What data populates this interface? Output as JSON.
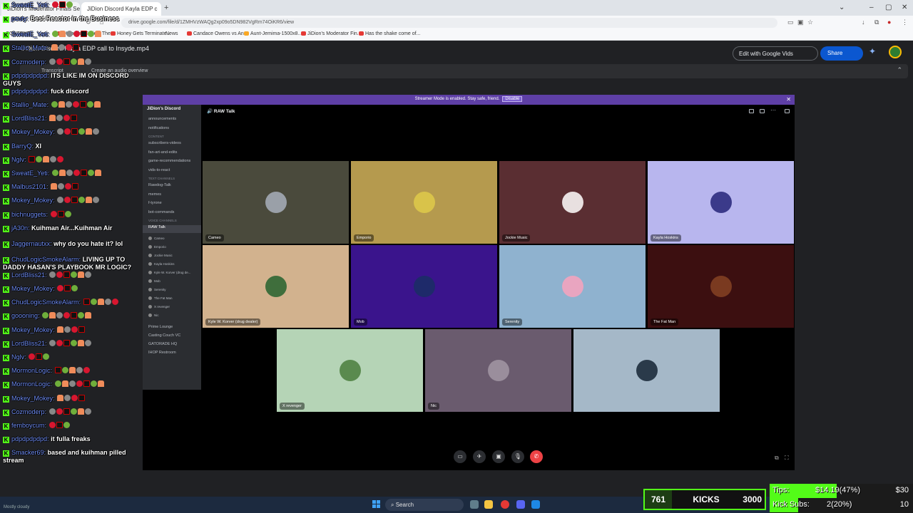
{
  "browser": {
    "tabs": [
      {
        "label": "JiDion's Moderator Finals Season"
      },
      {
        "label": "JiDion Discord Kayla EDP c"
      }
    ],
    "url": "drive.google.com/file/d/1ZMHVzWAQg2xp09o5DN982VgRm74OiKR6/view",
    "bookmarks": [
      "CONTENT",
      "Halo The Series, The...",
      "Honey Gets Terminate...",
      "News",
      "Candace Owens vs An...",
      "Aunt-Jemima-1500x8...",
      "JiDion's Moderator Fin...",
      "Has the shake come of..."
    ]
  },
  "drive": {
    "file_title": "JiDion Discord Kayla EDP call to Insyde.mp4",
    "edit_vids_label": "Edit with Google Vids",
    "share_label": "Share",
    "transcript_label": "Transcript",
    "audio_overview_label": "Create an audio overview"
  },
  "discord": {
    "banner_text": "Streamer Mode is enabled. Stay safe, friend.",
    "banner_disable": "Disable",
    "server_name": "JiDion's Discord",
    "channel_header": "RAW Talk",
    "channels": [
      {
        "label": "announcements",
        "type": "text"
      },
      {
        "label": "notifications",
        "type": "text"
      },
      {
        "label": "CONTENT",
        "type": "cat"
      },
      {
        "label": "subscribers-videos",
        "type": "text"
      },
      {
        "label": "fan-art-and-edits",
        "type": "text"
      },
      {
        "label": "game-recommendations",
        "type": "text"
      },
      {
        "label": "vids-to-react",
        "type": "text"
      },
      {
        "label": "TEXT CHANNELS",
        "type": "cat"
      },
      {
        "label": "Rawdog-Talk",
        "type": "text"
      },
      {
        "label": "memes",
        "type": "text"
      },
      {
        "label": "f-tyrone",
        "type": "text"
      },
      {
        "label": "bot-commands",
        "type": "text"
      },
      {
        "label": "VOICE CHANNELS",
        "type": "cat"
      },
      {
        "label": "RAW Talk",
        "type": "active"
      }
    ],
    "voice_members": [
      "Cameo",
      "Emporio",
      "Jockie Music",
      "Kayla Hoskins",
      "Kyle W. Korver (drug de...",
      "Mob",
      "Serenity",
      "The Fat Man",
      "X revenger",
      "Nic"
    ],
    "other_voice": [
      "Prime Lounge",
      "Casting Couch VC",
      "GATORADE HQ",
      "IHOP Restroom"
    ],
    "participants": [
      {
        "name": "Cameo",
        "bg": "#4a4a3c",
        "av": "#9aa0a8"
      },
      {
        "name": "Emporio",
        "bg": "#b59a4e",
        "av": "#d9c34a"
      },
      {
        "name": "Jockie Music",
        "bg": "#5a2e32",
        "av": "#e8e0e0"
      },
      {
        "name": "Kayla Hoskins",
        "bg": "#b8b6ee",
        "av": "#3b3a8a"
      },
      {
        "name": "Kyle W. Korver (drug dealer)",
        "bg": "#d2b28e",
        "av": "#3f6e3c"
      },
      {
        "name": "Mob",
        "bg": "#3a148c",
        "av": "#1e2a6a"
      },
      {
        "name": "Serenity",
        "bg": "#8fb2cf",
        "av": "#e9a5c0"
      },
      {
        "name": "The Fat Man",
        "bg": "#3c0f10",
        "av": "#7a3a20"
      },
      {
        "name": "X revenger",
        "bg": "#b5d4b6",
        "av": "#5a8a4e"
      },
      {
        "name": "Nic",
        "bg": "#6a5b6e",
        "av": "#9a8e9c"
      },
      {
        "name": "",
        "bg": "#a5b8c8",
        "av": "#2a3a4a"
      }
    ]
  },
  "chat": [
    {
      "user": "SweatE_Yeti:",
      "text": ""
    },
    {
      "user": "pcuty:",
      "text": "Best Reactor in the Business"
    },
    {
      "user": "SweatE_Yeti:",
      "text": ""
    },
    {
      "user": "Stallio_Mate:",
      "text": ""
    },
    {
      "user": "Cozmoderp:",
      "text": ""
    },
    {
      "user": "pdpdpdpdpd:",
      "text": "ITS LIKE IM ON DISCORD GUYS"
    },
    {
      "user": "pdpdpdpdpd:",
      "text": "fuck discord"
    },
    {
      "user": "Stallio_Mate:",
      "text": ""
    },
    {
      "user": "LordBliss21:",
      "text": ""
    },
    {
      "user": "Mokey_Mokey:",
      "text": ""
    },
    {
      "user": "BarryQ:",
      "text": "XI"
    },
    {
      "user": "Nglv:",
      "text": ""
    },
    {
      "user": "SweatE_Yeti:",
      "text": ""
    },
    {
      "user": "Malbus2101:",
      "text": ""
    },
    {
      "user": "Mokey_Mokey:",
      "text": ""
    },
    {
      "user": "bichnuggets:",
      "text": ""
    },
    {
      "user": "jA30n:",
      "text": "Kuihman Air...Kuihman Air"
    },
    {
      "user": "Jaggernautxx:",
      "text": "why do you hate it? lol"
    },
    {
      "user": "ChudLogicSmokeAlarm:",
      "text": "LIVING UP TO DADDY HASAN'S PLAYBOOK MR LOGIC?"
    },
    {
      "user": "LordBliss21:",
      "text": ""
    },
    {
      "user": "Mokey_Mokey:",
      "text": ""
    },
    {
      "user": "ChudLogicSmokeAlarm:",
      "text": ""
    },
    {
      "user": "goooning:",
      "text": ""
    },
    {
      "user": "Mokey_Mokey:",
      "text": ""
    },
    {
      "user": "LordBliss21:",
      "text": ""
    },
    {
      "user": "Nglv:",
      "text": ""
    },
    {
      "user": "MormonLogic:",
      "text": ""
    },
    {
      "user": "MormonLogic:",
      "text": ""
    },
    {
      "user": "Mokey_Mokey:",
      "text": ""
    },
    {
      "user": "Cozmoderp:",
      "text": ""
    },
    {
      "user": "femboycum:",
      "text": ""
    },
    {
      "user": "pdpdpdpdpd:",
      "text": "it fulla freaks"
    },
    {
      "user": "Smacker69:",
      "text": "based and kuihman pilled stream"
    }
  ],
  "taskbar": {
    "search_label": "Search",
    "tray_text": "Mostly cloudy"
  },
  "kicks": {
    "current": "761",
    "label": "KICKS",
    "goal": "3000"
  },
  "goals": {
    "tips_label": "Tips:",
    "tips_value": "$14.19(47%)",
    "tips_target": "$30",
    "tips_progress": 0.47,
    "subs_label": "Kick Subs:",
    "subs_value": "2(20%)",
    "subs_target": "10",
    "subs_progress": 0.2
  },
  "colors": {
    "kick_green": "#53fc18",
    "discord_bg": "#000000",
    "banner_purple": "#5e3fa6",
    "leave_red": "#ed4245"
  }
}
